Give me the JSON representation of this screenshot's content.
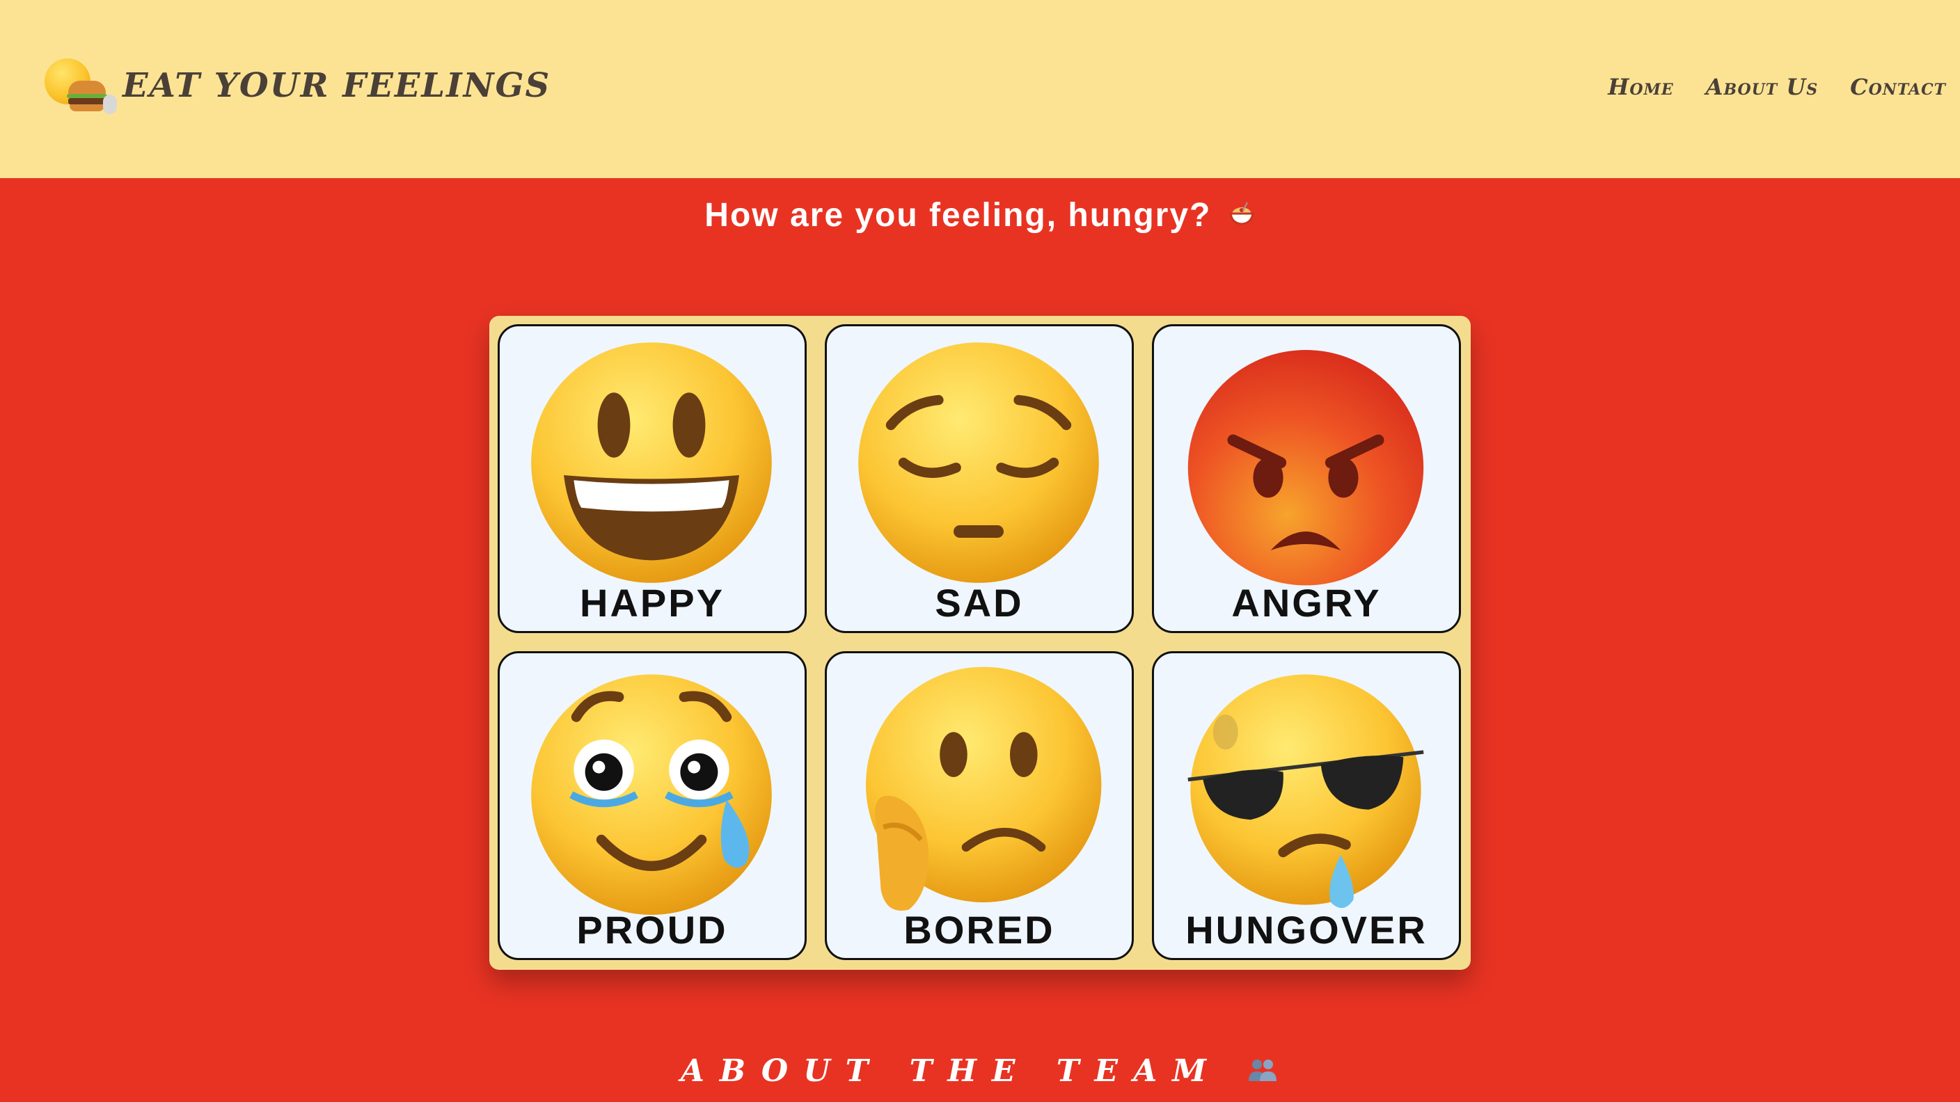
{
  "header": {
    "brand_title": "Eat Your Feelings",
    "brand_icon": "face-eating-burger-icon",
    "nav": [
      {
        "label": "Home"
      },
      {
        "label": "About Us"
      },
      {
        "label": "Contact"
      }
    ]
  },
  "hero": {
    "question": "How are you feeling, hungry?",
    "question_icon": "spaghetti-bowl-icon"
  },
  "moods": [
    {
      "label": "HAPPY",
      "icon": "grinning-face-icon"
    },
    {
      "label": "SAD",
      "icon": "pensive-face-icon"
    },
    {
      "label": "ANGRY",
      "icon": "angry-face-icon"
    },
    {
      "label": "PROUD",
      "icon": "face-holding-back-tears-icon"
    },
    {
      "label": "BORED",
      "icon": "thinking-frown-face-icon"
    },
    {
      "label": "HUNGOVER",
      "icon": "sunglasses-drool-face-icon"
    }
  ],
  "about": {
    "heading": "About the Team",
    "heading_icon": "busts-in-silhouette-icon"
  },
  "colors": {
    "header_bg": "#fce394",
    "page_bg": "#e83323",
    "panel_bg": "#f4dc8f",
    "card_bg": "#eff6fd",
    "text_dark": "#4a4037"
  }
}
